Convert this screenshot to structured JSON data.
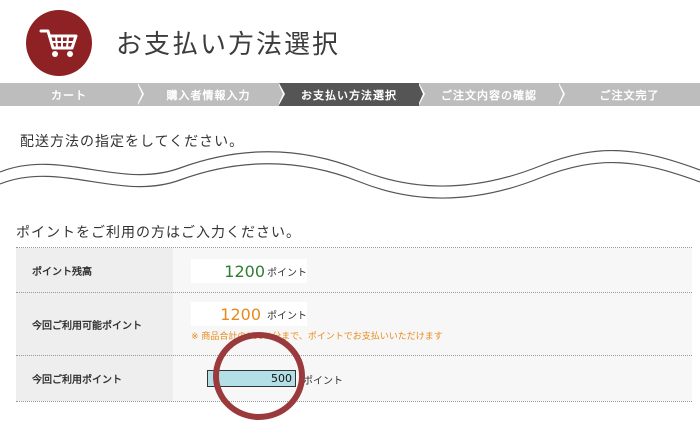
{
  "header": {
    "title": "お支払い方法選択",
    "icon": "shopping-cart-icon",
    "icon_bg": "#8e2124"
  },
  "steps": [
    {
      "label": "カート",
      "active": false
    },
    {
      "label": "購入者情報入力",
      "active": false
    },
    {
      "label": "お支払い方法選択",
      "active": true
    },
    {
      "label": "ご注文内容の確認",
      "active": false
    },
    {
      "label": "ご注文完了",
      "active": false
    }
  ],
  "delivery": {
    "heading": "配送方法の指定をしてください。"
  },
  "points": {
    "heading": "ポイントをご利用の方はご入力ください。",
    "balance": {
      "label": "ポイント残高",
      "value": "1200",
      "unit": "ポイント"
    },
    "available": {
      "label": "今回ご利用可能ポイント",
      "value": "1200",
      "unit": "ポイント",
      "note": "※ 商品合計の100%分まで、ポイントでお支払いいただけます"
    },
    "use": {
      "label": "今回ご利用ポイント",
      "value": "500",
      "unit": "ポイント"
    }
  },
  "colors": {
    "active_step": "#555555",
    "inactive_step": "#bdbdbd",
    "green": "#2e7d32",
    "orange": "#e88a1a",
    "highlight_circle": "#9a3a3c"
  }
}
